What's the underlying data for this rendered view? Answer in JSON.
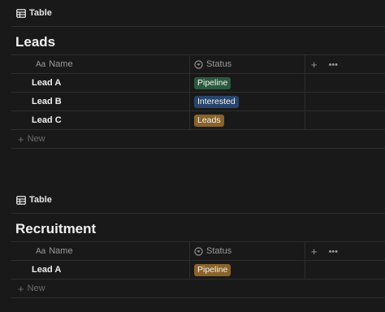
{
  "databases": [
    {
      "view_label": "Table",
      "title": "Leads",
      "columns": {
        "name": "Name",
        "name_icon": "Aa",
        "status": "Status"
      },
      "rows": [
        {
          "name": "Lead A",
          "status": "Pipeline"
        },
        {
          "name": "Lead B",
          "status": "Interested"
        },
        {
          "name": "Lead C",
          "status": "Leads"
        }
      ],
      "new_label": "New"
    },
    {
      "view_label": "Table",
      "title": "Recruitment",
      "columns": {
        "name": "Name",
        "name_icon": "Aa",
        "status": "Status"
      },
      "rows": [
        {
          "name": "Lead A",
          "status": "Pipeline"
        }
      ],
      "new_label": "New"
    }
  ],
  "status_colors": {
    "Pipeline_db1": "#2b593f",
    "Interested": "#28456c",
    "Leads": "#89632a",
    "Pipeline_db2": "#89632a"
  },
  "icons": {
    "add": "+",
    "more": "•••"
  }
}
